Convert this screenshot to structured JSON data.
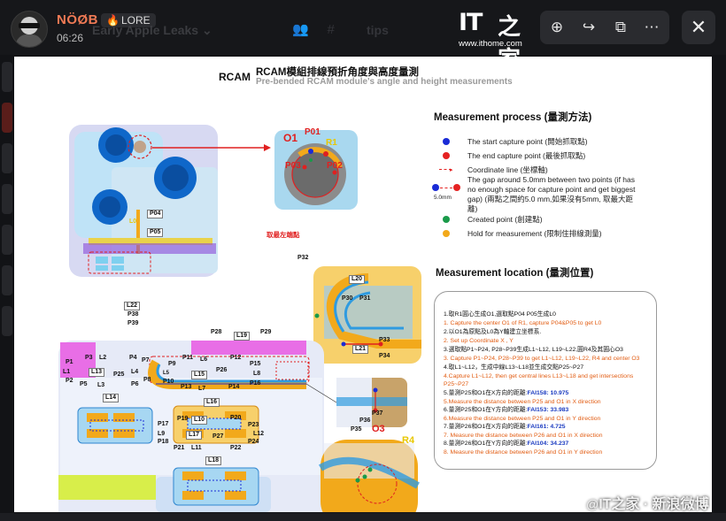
{
  "header": {
    "username": "NÖØB",
    "badge_icon": "flame-icon",
    "badge_label": "LORE",
    "timestamp": "06:26",
    "background_title": "Early Apple Leaks",
    "background_tab": "tips"
  },
  "watermark": {
    "logo_it": "IT",
    "logo_cn": "之家",
    "url": "www.ithome.com"
  },
  "toolbar": {
    "zoom_icon": "⊕",
    "share_icon": "↪",
    "external_icon": "⧉",
    "more_icon": "⋯",
    "close_icon": "✕"
  },
  "caption": {
    "prefix": "@",
    "text": "IT之家 · 新浪微博"
  },
  "doc": {
    "rcam": "RCAM",
    "title": "RCAM模組排線預折角度與高度量測",
    "subtitle": "Pre-bended RCAM module's angle and height measurements",
    "process_title": "Measurement process (量測方法)",
    "legend": [
      {
        "text": "The start capture point  (開始抓取點)",
        "color": "#1a2bd6"
      },
      {
        "text": "The end capture point  (最後抓取點)",
        "color": "#e52222"
      },
      {
        "text": "Coordinate line  (坐標軸)",
        "color": "#e52222"
      },
      {
        "text": "The gap around 5.0mm between two points (if has no enough space for capture point and get biggest gap)  (兩點之間約5.0 mm,如果沒有5mm, 取最大距離)",
        "color": "#1a2bd6"
      },
      {
        "text": "Created point  (創建點)",
        "color": "#1a9a4a"
      },
      {
        "text": "Hold for measurement  (限制住排線測量)",
        "color": "#f2a91b"
      }
    ],
    "gap_label": "5.0mm",
    "location_title": "Measurement location (量測位置)",
    "steps": [
      {
        "text": "1.取R1圓心生成O1,選取點P04 P05生成L0",
        "style": "b"
      },
      {
        "text": "1. Capture the center O1 of R1, capture P04&P05 to get L0",
        "style": "o"
      },
      {
        "text": "2.以O1為原點及L0為Y軸建立坐標系.",
        "style": "b"
      },
      {
        "text": "2. Set up Coordinate  X , Y",
        "style": "o"
      },
      {
        "text": "3.選取點P1~P24, P28~P39生成L1~L12, L19~L22,圓R4及其圓心O3",
        "style": "b"
      },
      {
        "text": "3. Capture P1~P24, P28~P39 to get L1~L12, L19~L22, R4 and center O3",
        "style": "o"
      },
      {
        "text": "4.取L1~L12，生成中線L13~L18並生成交點P25~P27",
        "style": "b"
      },
      {
        "text": "4.Capture L1~L12, then get central lines L13~L18 and get intersections",
        "style": "o"
      },
      {
        "text": "P25~P27",
        "style": "o"
      },
      {
        "text": "5.量測P25和O1在X方向的距離:",
        "style": "b",
        "fai": "FAI158: 10.975"
      },
      {
        "text": "5.Measure the distance between P25 and O1 in X direction",
        "style": "o"
      },
      {
        "text": "6.量測P25和O1在Y方向的距離:",
        "style": "b",
        "fai": "FAI153: 33.983"
      },
      {
        "text": "6.Measure the distance between P25 and O1 in Y direction",
        "style": "o"
      },
      {
        "text": "7.量測P26和O1在X方向的距離:",
        "style": "b",
        "fai": "FAI161: 4.725"
      },
      {
        "text": "7. Measure the distance between P26 and O1 in X direction",
        "style": "o"
      },
      {
        "text": "8.量測P26和O1在Y方向的距離:",
        "style": "b",
        "fai": "FAI104: 34.237"
      },
      {
        "text": "8. Measure the distance between P26 and O1 in Y direction",
        "style": "o"
      }
    ],
    "note_leftmost": "取最左端點",
    "labels": {
      "O1": "O1",
      "P01": "P01",
      "R1": "R1",
      "P03": "P03",
      "P02": "P02",
      "P04": "P04",
      "L0": "L0",
      "P05": "P05",
      "P32": "P32",
      "L20": "L20",
      "P30": "P30",
      "P31": "P31",
      "L22": "L22",
      "P38": "P38",
      "P39": "P39",
      "P28": "P28",
      "L19": "L19",
      "P29": "P29",
      "P33": "P33",
      "L21": "L21",
      "P34": "P34",
      "P37": "P37",
      "P36": "P36",
      "P35": "P35",
      "O3": "O3",
      "R4": "R4",
      "P1": "P1",
      "L1": "L1",
      "P2": "P2",
      "P3": "P3",
      "L2": "L2",
      "P4": "P4",
      "P7": "P7",
      "L13": "L13",
      "P25": "P25",
      "L4": "L4",
      "P5": "P5",
      "L3": "L3",
      "P6": "P6",
      "P8": "P8",
      "L14": "L14",
      "P9": "P9",
      "P11": "P11",
      "L6": "L6",
      "P12": "P12",
      "P15": "P15",
      "L5": "L5",
      "P10": "P10",
      "L15": "L15",
      "P26": "P26",
      "L8": "L8",
      "P13": "P13",
      "L7": "L7",
      "P14": "P14",
      "P16": "P16",
      "L16": "L16",
      "P19": "P19",
      "L10": "L10",
      "P20": "P20",
      "P17": "P17",
      "L9": "L9",
      "L17": "L17",
      "P27": "P27",
      "L12": "L12",
      "P18": "P18",
      "P21": "P21",
      "L11": "L11",
      "P22": "P22",
      "P24": "P24",
      "P23": "P23",
      "L18": "L18"
    }
  }
}
